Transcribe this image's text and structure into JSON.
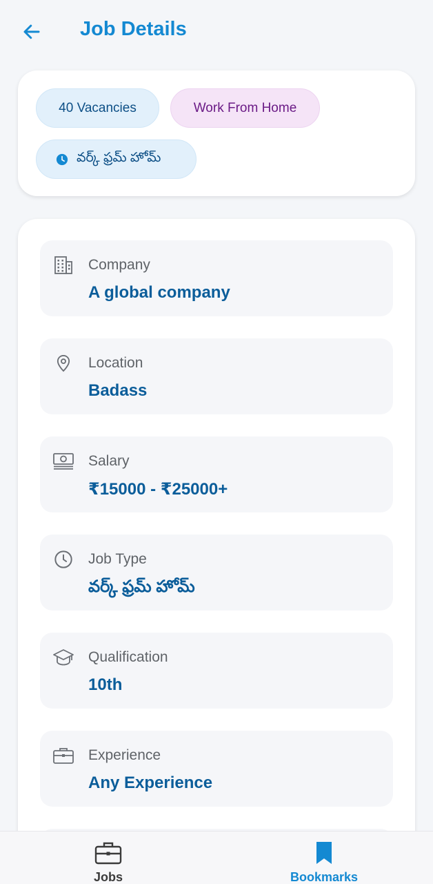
{
  "header": {
    "title": "Job Details",
    "back_icon": "arrow-left-icon"
  },
  "tags": {
    "vacancies": "40 Vacancies",
    "work_mode": "Work From Home",
    "job_type": "వర్క్ ఫ్రమ్ హోమ్"
  },
  "details": [
    {
      "label": "Company",
      "value": "A global company",
      "icon": "building-icon"
    },
    {
      "label": "Location",
      "value": "Badass",
      "icon": "location-pin-icon"
    },
    {
      "label": "Salary",
      "value": "₹15000 - ₹25000+",
      "icon": "cash-icon"
    },
    {
      "label": "Job Type",
      "value": "వర్క్ ఫ్రమ్ హోమ్",
      "icon": "clock-icon"
    },
    {
      "label": "Qualification",
      "value": "10th",
      "icon": "graduation-cap-icon"
    },
    {
      "label": "Experience",
      "value": "Any Experience",
      "icon": "briefcase-icon"
    }
  ],
  "bottom_nav": {
    "items": [
      {
        "label": "Jobs",
        "icon": "briefcase-icon",
        "active": false
      },
      {
        "label": "Bookmarks",
        "icon": "bookmark-icon",
        "active": true
      }
    ]
  },
  "colors": {
    "accent": "#1489d2",
    "value_text": "#0b5d9a",
    "chip_blue_bg": "#e2f0fb",
    "chip_purple_bg": "#f5e4f7",
    "chip_purple_text": "#6b1b86"
  }
}
